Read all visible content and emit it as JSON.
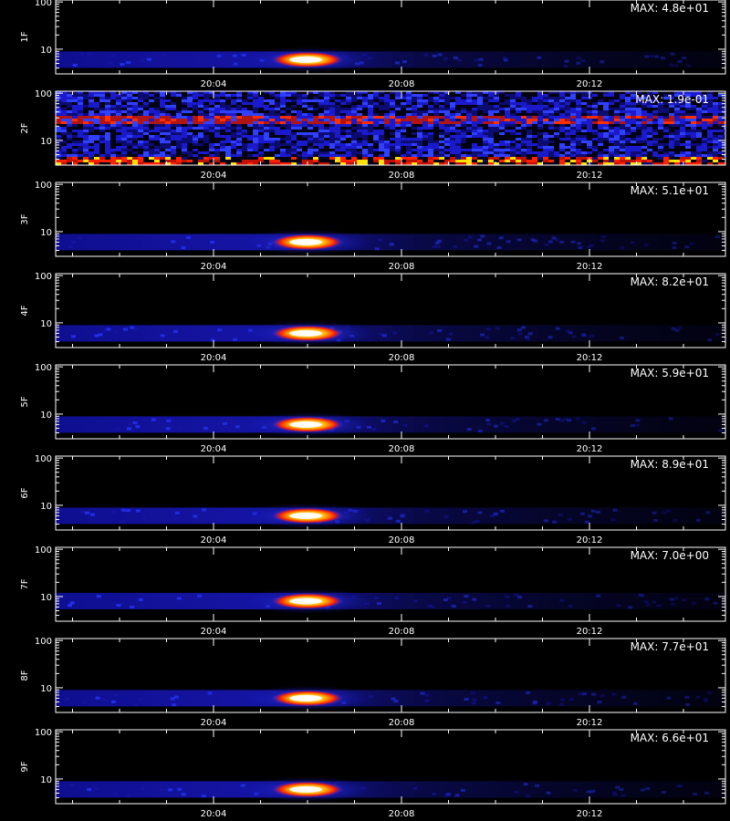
{
  "chart_data": [
    {
      "type": "heatmap",
      "ylabel": "1F",
      "max_label": "MAX: 4.8e+01",
      "xtick_labels": [
        "20:04",
        "20:08",
        "20:12"
      ],
      "ytick_labels": [
        "10",
        "100"
      ],
      "yscale": "log",
      "ylim": [
        3,
        110
      ],
      "pattern": "burst",
      "burst": {
        "center_time": "20:06",
        "freq": 6
      }
    },
    {
      "type": "heatmap",
      "ylabel": "2F",
      "max_label": "MAX: 1.9e-01",
      "xtick_labels": [
        "20:04",
        "20:08",
        "20:12"
      ],
      "ytick_labels": [
        "10",
        "100"
      ],
      "yscale": "log",
      "ylim": [
        3,
        110
      ],
      "pattern": "noise",
      "bands": [
        {
          "freq": 30,
          "level": "high"
        },
        {
          "freq": 4,
          "level": "high"
        }
      ]
    },
    {
      "type": "heatmap",
      "ylabel": "3F",
      "max_label": "MAX: 5.1e+01",
      "xtick_labels": [
        "20:04",
        "20:08",
        "20:12"
      ],
      "ytick_labels": [
        "10",
        "100"
      ],
      "yscale": "log",
      "ylim": [
        3,
        110
      ],
      "pattern": "burst",
      "burst": {
        "center_time": "20:06",
        "freq": 6
      }
    },
    {
      "type": "heatmap",
      "ylabel": "4F",
      "max_label": "MAX: 8.2e+01",
      "xtick_labels": [
        "20:04",
        "20:08",
        "20:12"
      ],
      "ytick_labels": [
        "10",
        "100"
      ],
      "yscale": "log",
      "ylim": [
        3,
        110
      ],
      "pattern": "burst",
      "burst": {
        "center_time": "20:06",
        "freq": 6
      }
    },
    {
      "type": "heatmap",
      "ylabel": "5F",
      "max_label": "MAX: 5.9e+01",
      "xtick_labels": [
        "20:04",
        "20:08",
        "20:12"
      ],
      "ytick_labels": [
        "10",
        "100"
      ],
      "yscale": "log",
      "ylim": [
        3,
        110
      ],
      "pattern": "burst",
      "burst": {
        "center_time": "20:06",
        "freq": 6
      }
    },
    {
      "type": "heatmap",
      "ylabel": "6F",
      "max_label": "MAX: 8.9e+01",
      "xtick_labels": [
        "20:04",
        "20:08",
        "20:12"
      ],
      "ytick_labels": [
        "10",
        "100"
      ],
      "yscale": "log",
      "ylim": [
        3,
        110
      ],
      "pattern": "burst",
      "burst": {
        "center_time": "20:06",
        "freq": 6
      }
    },
    {
      "type": "heatmap",
      "ylabel": "7F",
      "max_label": "MAX: 7.0e+00",
      "xtick_labels": [
        "20:04",
        "20:08",
        "20:12"
      ],
      "ytick_labels": [
        "10",
        "100"
      ],
      "yscale": "log",
      "ylim": [
        3,
        110
      ],
      "pattern": "burst",
      "burst": {
        "center_time": "20:06",
        "freq": 8
      }
    },
    {
      "type": "heatmap",
      "ylabel": "8F",
      "max_label": "MAX: 7.7e+01",
      "xtick_labels": [
        "20:04",
        "20:08",
        "20:12"
      ],
      "ytick_labels": [
        "10",
        "100"
      ],
      "yscale": "log",
      "ylim": [
        3,
        110
      ],
      "pattern": "burst",
      "burst": {
        "center_time": "20:06",
        "freq": 6
      }
    },
    {
      "type": "heatmap",
      "ylabel": "9F",
      "max_label": "MAX: 6.6e+01",
      "xtick_labels": [
        "20:04",
        "20:08",
        "20:12"
      ],
      "ytick_labels": [
        "10",
        "100"
      ],
      "yscale": "log",
      "ylim": [
        3,
        110
      ],
      "pattern": "burst",
      "burst": {
        "center_time": "20:06",
        "freq": 6
      }
    }
  ],
  "colors": {
    "background": "#000000",
    "blue": "#1a2bff",
    "red": "#ff2000",
    "yellow": "#ffe000",
    "white": "#ffffff"
  }
}
